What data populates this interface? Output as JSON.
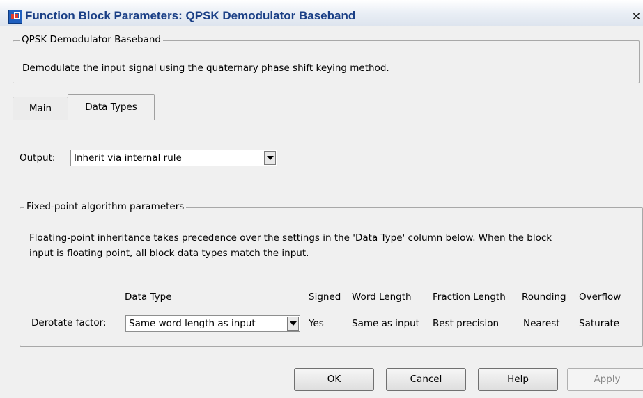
{
  "window": {
    "title": "Function Block Parameters: QPSK Demodulator Baseband",
    "close_glyph": "✕"
  },
  "description": {
    "group_title": "QPSK Demodulator Baseband",
    "text": "Demodulate the input signal using the quaternary phase shift keying method."
  },
  "tabs": [
    {
      "label": "Main",
      "active": false
    },
    {
      "label": "Data Types",
      "active": true
    }
  ],
  "output": {
    "label": "Output:",
    "value": "Inherit via internal rule"
  },
  "fixed_point": {
    "group_title": "Fixed-point algorithm parameters",
    "note_line1": "Floating-point inheritance takes precedence over the settings in the 'Data Type' column below. When the block",
    "note_line2": "input is floating point, all block data types match the input.",
    "columns": {
      "data_type": "Data Type",
      "signed": "Signed",
      "word_length": "Word Length",
      "fraction_length": "Fraction Length",
      "rounding": "Rounding",
      "overflow": "Overflow"
    },
    "row": {
      "label": "Derotate factor:",
      "data_type": "Same word length as input",
      "signed": "Yes",
      "word_length": "Same as input",
      "fraction_length": "Best precision",
      "rounding": "Nearest",
      "overflow": "Saturate"
    }
  },
  "buttons": {
    "ok": "OK",
    "cancel": "Cancel",
    "help": "Help",
    "apply": "Apply"
  },
  "icons": {
    "app": "simulink-block-icon",
    "close": "close-icon",
    "dropdown": "chevron-down-icon"
  }
}
